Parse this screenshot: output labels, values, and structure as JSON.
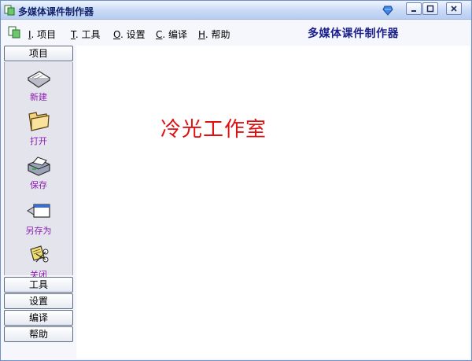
{
  "window": {
    "title": "多媒体课件制作器"
  },
  "menubar": {
    "items": [
      {
        "key": "I",
        "label": ". 项目"
      },
      {
        "key": "T",
        "label": ". 工具"
      },
      {
        "key": "O",
        "label": ". 设置"
      },
      {
        "key": "C",
        "label": ". 编译"
      },
      {
        "key": "H",
        "label": ". 帮助"
      }
    ],
    "heading": "多媒体课件制作器"
  },
  "sidebar": {
    "project_header": "项目",
    "tools": [
      {
        "label": "新建",
        "icon": "new-file-icon"
      },
      {
        "label": "打开",
        "icon": "open-folder-icon"
      },
      {
        "label": "保存",
        "icon": "save-printer-icon"
      },
      {
        "label": "另存为",
        "icon": "save-as-window-icon"
      },
      {
        "label": "关闭",
        "icon": "close-doc-icon"
      }
    ],
    "sections": [
      "工具",
      "设置",
      "编译",
      "帮助"
    ]
  },
  "canvas": {
    "text": "冷光工作室"
  },
  "colors": {
    "accent": "#1a1f8a",
    "tool_label": "#8a1cb0",
    "canvas_text": "#e01010"
  }
}
